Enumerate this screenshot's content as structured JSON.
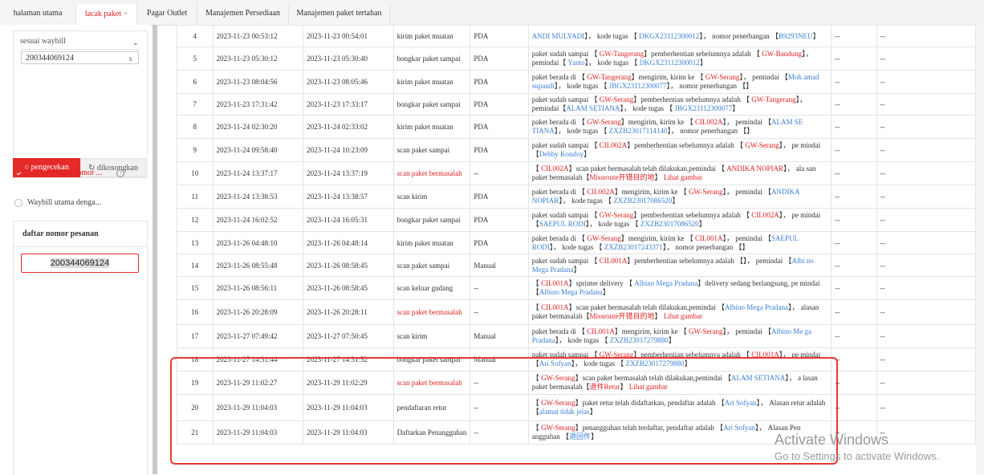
{
  "tabs": [
    "halaman utama",
    "lacak paket",
    "Pagar Outlet",
    "Manajemen Persediaan",
    "Manajemen paket tertahan"
  ],
  "sidebar": {
    "select_value": "sesuai waybill",
    "input_value": "200344069124",
    "check_btn": "pengecekan",
    "clear_btn": "dikosongkan",
    "opt1": "cek informasi nomor ...",
    "opt2": "Waybill utama denga...",
    "list_title": "daftar nomor pesanan",
    "list_item": "200344069124"
  },
  "rows": [
    {
      "n": "4",
      "t1": "2023-11-23 00:53:12",
      "t2": "2023-11-23 00:54:01",
      "act": "kirim paket muatan",
      "src": "PDA",
      "desc": [
        [
          "b",
          "ANDI MULYADI"
        ],
        [
          "",
          "】， kode tugas 【 "
        ],
        [
          "b",
          "DKGX23112300012"
        ],
        [
          "",
          "】， nomor penerbangan 【"
        ],
        [
          "b",
          "B9293"
        ],
        [
          "",
          ""
        ],
        [
          "b",
          "NEU"
        ],
        [
          "",
          "】"
        ]
      ],
      "c1": "--",
      "c2": "--"
    },
    {
      "n": "5",
      "t1": "2023-11-23 05:30:12",
      "t2": "2023-11-23 05:30:40",
      "act": "bongkar paket sampai",
      "src": "PDA",
      "desc": [
        [
          "",
          "paket sudah sampai 【 "
        ],
        [
          "r",
          "GW-Tangerang"
        ],
        [
          "",
          "】pemberhentian sebelumnya adalah 【 "
        ],
        [
          "r",
          "GW-Bandung"
        ],
        [
          "",
          ""
        ],
        [
          "",
          "】， pemindai【 "
        ],
        [
          "b",
          "Yanto"
        ],
        [
          "",
          "】， kode tugas 【 "
        ],
        [
          "b",
          "DKGX23112300012"
        ],
        [
          "",
          "】"
        ]
      ],
      "c1": "--",
      "c2": "--"
    },
    {
      "n": "6",
      "t1": "2023-11-23 08:04:56",
      "t2": "2023-11-23 08:05:46",
      "act": "kirim paket muatan",
      "src": "PDA",
      "desc": [
        [
          "",
          "paket berada di 【 "
        ],
        [
          "r",
          "GW-Tangerang"
        ],
        [
          "",
          "】mengirim, kirim ke 【 "
        ],
        [
          "r",
          "GW-Serang"
        ],
        [
          "",
          "】， pemindai 【"
        ],
        [
          "b",
          "Moh amad supandi"
        ],
        [
          "",
          "】， kode tugas 【 "
        ],
        [
          "b",
          "JBGX23112300077"
        ],
        [
          "",
          "】， nomor penerbangan 【】"
        ]
      ],
      "c1": "--",
      "c2": "--"
    },
    {
      "n": "7",
      "t1": "2023-11-23 17:31:42",
      "t2": "2023-11-23 17:33:17",
      "act": "bongkar paket sampai",
      "src": "PDA",
      "desc": [
        [
          "",
          "paket sudah sampai 【 "
        ],
        [
          "r",
          "GW-Serang"
        ],
        [
          "",
          "】pemberhentian sebelumnya adalah 【 "
        ],
        [
          "r",
          "GW-Tangerang"
        ],
        [
          "",
          "】， pemindai【"
        ],
        [
          "b",
          "ALAM SETIANA"
        ],
        [
          "",
          "】， kode tugas 【 "
        ],
        [
          "b",
          "JBGX23112300077"
        ],
        [
          "",
          "】"
        ]
      ],
      "c1": "--",
      "c2": "--"
    },
    {
      "n": "8",
      "t1": "2023-11-24 02:30:20",
      "t2": "2023-11-24 02:33:02",
      "act": "kirim paket muatan",
      "src": "PDA",
      "desc": [
        [
          "",
          "paket berada di 【 "
        ],
        [
          "r",
          "GW-Serang"
        ],
        [
          "",
          "】mengirim, kirim ke 【 "
        ],
        [
          "r",
          "CIL002A"
        ],
        [
          "",
          "】， pemindai 【"
        ],
        [
          "b",
          "ALAM SE TIANA"
        ],
        [
          "",
          "】， kode tugas 【 "
        ],
        [
          "b",
          "ZXZB23017114140"
        ],
        [
          "",
          "】， nomor penerbangan 【】"
        ]
      ],
      "c1": "--",
      "c2": "--"
    },
    {
      "n": "9",
      "t1": "2023-11-24 09:58:40",
      "t2": "2023-11-24 10:23:09",
      "act": "scan paket sampai",
      "src": "PDA",
      "desc": [
        [
          "",
          "paket sudah sampai 【 "
        ],
        [
          "r",
          "CIL002A"
        ],
        [
          "",
          "】pemberhentian sebelumnya adalah 【 "
        ],
        [
          "r",
          "GW-Serang"
        ],
        [
          "",
          "】， pe mindai 【"
        ],
        [
          "b",
          "Debby Kondoy"
        ],
        [
          "",
          "】"
        ]
      ],
      "c1": "--",
      "c2": "--"
    },
    {
      "n": "10",
      "t1": "2023-11-24 13:37:17",
      "t2": "2023-11-24 13:37:19",
      "act": "scan paket bermasalah",
      "actRed": true,
      "src": "--",
      "desc": [
        [
          "",
          "【 "
        ],
        [
          "r",
          "CIL002A"
        ],
        [
          "",
          "】scan paket bermasalah telah dilakukan,pemindai 【 "
        ],
        [
          "r",
          "ANDIKA NOPIAR"
        ],
        [
          "",
          "】， ala san paket bermasalah【"
        ],
        [
          "r",
          "Missroute开错目的地"
        ],
        [
          "",
          "】 "
        ],
        [
          "r",
          "Lihat gambar"
        ]
      ],
      "c1": "--",
      "c2": "--"
    },
    {
      "n": "11",
      "t1": "2023-11-24 13:38:53",
      "t2": "2023-11-24 13:38:57",
      "act": "scan kirim",
      "src": "PDA",
      "desc": [
        [
          "",
          "paket berada di 【 "
        ],
        [
          "r",
          "CIL002A"
        ],
        [
          "",
          "】mengirim, kirim ke 【 "
        ],
        [
          "r",
          "GW-Serang"
        ],
        [
          "",
          "】， pemindai 【"
        ],
        [
          "b",
          "ANDIKA NOPIAR"
        ],
        [
          "",
          "】， kode tugas 【 "
        ],
        [
          "b",
          "ZXZB23017086520"
        ],
        [
          "",
          "】"
        ]
      ],
      "c1": "--",
      "c2": "--"
    },
    {
      "n": "12",
      "t1": "2023-11-24 16:02:52",
      "t2": "2023-11-24 16:05:31",
      "act": "bongkar paket sampai",
      "src": "PDA",
      "desc": [
        [
          "",
          "paket sudah sampai 【 "
        ],
        [
          "r",
          "GW-Serang"
        ],
        [
          "",
          "】pemberhentian sebelumnya adalah 【 "
        ],
        [
          "r",
          "CIL002A"
        ],
        [
          "",
          "】， pe mindai 【"
        ],
        [
          "b",
          "SAEPUL RODI"
        ],
        [
          "",
          "】， kode tugas 【 "
        ],
        [
          "b",
          "ZXZB23017086520"
        ],
        [
          "",
          "】"
        ]
      ],
      "c1": "--",
      "c2": "--"
    },
    {
      "n": "13",
      "t1": "2023-11-26 04:48:10",
      "t2": "2023-11-26 04:48:14",
      "act": "kirim paket muatan",
      "src": "PDA",
      "desc": [
        [
          "",
          "paket berada di 【 "
        ],
        [
          "r",
          "GW-Serang"
        ],
        [
          "",
          "】mengirim, kirim ke 【 "
        ],
        [
          "r",
          "CIL001A"
        ],
        [
          "",
          "】， pemindai 【"
        ],
        [
          "b",
          "SAEPUL RODI"
        ],
        [
          "",
          "】， kode tugas 【 "
        ],
        [
          "b",
          "ZXZB23017243371"
        ],
        [
          "",
          "】， nomor penerbangan 【】"
        ]
      ],
      "c1": "--",
      "c2": "--"
    },
    {
      "n": "14",
      "t1": "2023-11-26 08:55:48",
      "t2": "2023-11-26 08:58:45",
      "act": "scan paket sampai",
      "src": "Manual",
      "desc": [
        [
          "",
          "paket sudah sampai 【 "
        ],
        [
          "r",
          "CIL001A"
        ],
        [
          "",
          "】pemberhentian sebelumnya adalah 【】， pemindai 【"
        ],
        [
          "b",
          "Albi no Mega Pradana"
        ],
        [
          "",
          "】"
        ]
      ],
      "c1": "--",
      "c2": "--"
    },
    {
      "n": "15",
      "t1": "2023-11-26 08:56:11",
      "t2": "2023-11-26 08:58:45",
      "act": "scan keluar gudang",
      "src": "--",
      "desc": [
        [
          "",
          "【 "
        ],
        [
          "r",
          "CIL001A"
        ],
        [
          "",
          "】sprinter delivery 【 "
        ],
        [
          "b",
          "Albino Mega Pradana"
        ],
        [
          "",
          "】delivery sedang berlangsung, pe mindai 【"
        ],
        [
          "b",
          "Albino Mega Pradana"
        ],
        [
          "",
          "】"
        ]
      ],
      "c1": "--",
      "c2": "--"
    },
    {
      "n": "16",
      "t1": "2023-11-26 20:28:09",
      "t2": "2023-11-26 20:28:11",
      "act": "scan paket bermasalah",
      "actRed": true,
      "src": "--",
      "desc": [
        [
          "",
          "【 "
        ],
        [
          "r",
          "CIL001A"
        ],
        [
          "",
          "】scan paket bermasalah telah dilakukan,pemindai 【"
        ],
        [
          "b",
          "Albino Mega Pradana"
        ],
        [
          "",
          "】， alasan paket bermasalah【"
        ],
        [
          "r",
          "Missroute开错目的地"
        ],
        [
          "",
          "】 "
        ],
        [
          "r",
          "Lihat gambar"
        ]
      ],
      "c1": "--",
      "c2": "--"
    },
    {
      "n": "17",
      "t1": "2023-11-27 07:49:42",
      "t2": "2023-11-27 07:50:45",
      "act": "scan kirim",
      "src": "Manual",
      "desc": [
        [
          "",
          "paket berada di 【 "
        ],
        [
          "r",
          "CIL001A"
        ],
        [
          "",
          "】mengirim, kirim ke 【 "
        ],
        [
          "r",
          "GW-Serang"
        ],
        [
          "",
          "】， pemindai 【"
        ],
        [
          "b",
          "Albino Me ga Pradana"
        ],
        [
          "",
          "】， kode tugas 【 "
        ],
        [
          "b",
          "ZXZB23017279880"
        ],
        [
          "",
          "】"
        ]
      ],
      "c1": "--",
      "c2": "--"
    },
    {
      "n": "18",
      "t1": "2023-11-27 14:31:44",
      "t2": "2023-11-27 14:31:52",
      "act": "bongkar paket sampai",
      "src": "Manual",
      "desc": [
        [
          "",
          "paket sudah sampai 【 "
        ],
        [
          "r",
          "GW-Serang"
        ],
        [
          "",
          "】pemberhentian sebelumnya adalah 【 "
        ],
        [
          "r",
          "CIL001A"
        ],
        [
          "",
          "】， pe mindai 【"
        ],
        [
          "b",
          "Ari Sofyan"
        ],
        [
          "",
          "】， kode tugas 【 "
        ],
        [
          "b",
          "ZXZB23017279880"
        ],
        [
          "",
          "】"
        ]
      ],
      "c1": "--",
      "c2": "--"
    },
    {
      "n": "19",
      "t1": "2023-11-29 11:02:27",
      "t2": "2023-11-29 11:02:29",
      "act": "scan paket bermasalah",
      "actRed": true,
      "src": "--",
      "desc": [
        [
          "",
          "【 "
        ],
        [
          "r",
          "GW-Serang"
        ],
        [
          "",
          "】scan paket bermasalah telah dilakukan,pemindai 【"
        ],
        [
          "b",
          "ALAM SETIANA"
        ],
        [
          "",
          "】， a lasan paket bermasalah【"
        ],
        [
          "r",
          "退件Retur"
        ],
        [
          "",
          "】 "
        ],
        [
          "r",
          "Lihat gambar"
        ]
      ],
      "c1": "--",
      "c2": "--"
    },
    {
      "n": "20",
      "t1": "2023-11-29 11:04:03",
      "t2": "2023-11-29 11:04:03",
      "act": "pendaftaran retur",
      "src": "--",
      "desc": [
        [
          "",
          "【 "
        ],
        [
          "r",
          "GW-Serang"
        ],
        [
          "",
          "】paket retur telah didaftarkan, pendaftar adalah 【"
        ],
        [
          "b",
          "Ari Sofyan"
        ],
        [
          "",
          "】， Alasan retur adalah 【"
        ],
        [
          "b",
          "alamat tidak jelas"
        ],
        [
          "",
          "】"
        ]
      ],
      "c1": "--",
      "c2": "--"
    },
    {
      "n": "21",
      "t1": "2023-11-29 11:04:03",
      "t2": "2023-11-29 11:04:03",
      "act": "Daftarkan Penangguhan",
      "src": "--",
      "desc": [
        [
          "",
          "【 "
        ],
        [
          "r",
          "GW-Serang"
        ],
        [
          "",
          "】penangguhan telah terdaftar, pendaftar adalah 【"
        ],
        [
          "b",
          "Ari Sofyan"
        ],
        [
          "",
          "】， Alasan Pen angguhan 【"
        ],
        [
          "b",
          "退回件"
        ],
        [
          "",
          "】"
        ]
      ],
      "c1": "--",
      "c2": "--"
    }
  ],
  "watermark": {
    "line1": "Activate Windows",
    "line2": "Go to Settings to activate Windows."
  }
}
